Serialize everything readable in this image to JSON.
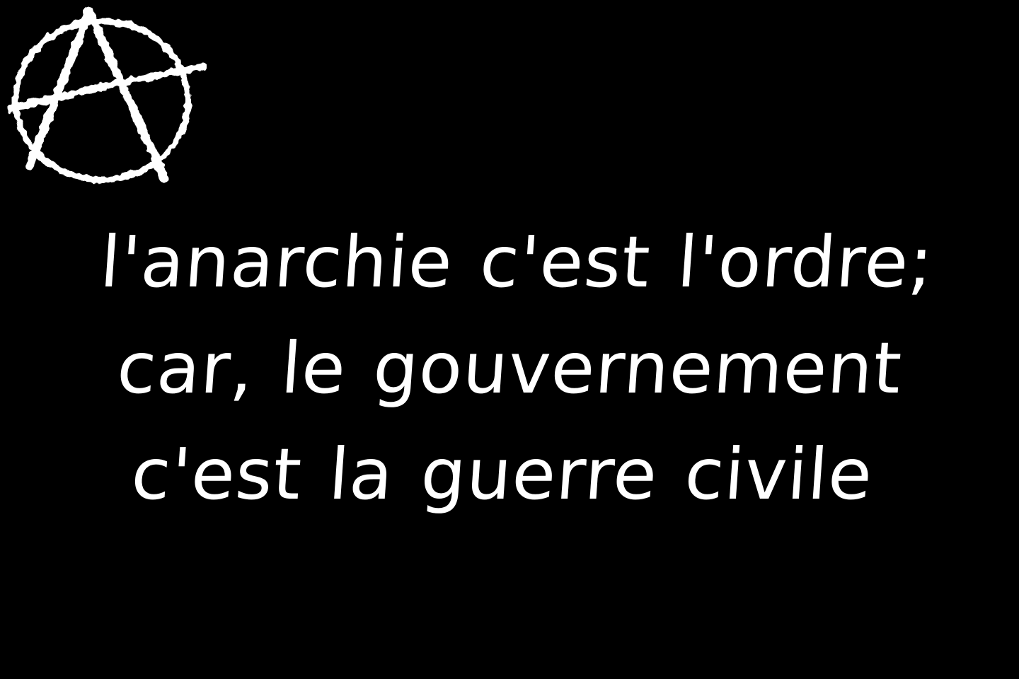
{
  "logo": {
    "icon": "anarchy-symbol-icon",
    "color": "#ffffff"
  },
  "background_color": "#000000",
  "text_color": "#ffffff",
  "quote": {
    "lines": [
      "l'anarchie c'est l'ordre;",
      "car, le gouvernement",
      "c'est la guerre civile"
    ]
  }
}
